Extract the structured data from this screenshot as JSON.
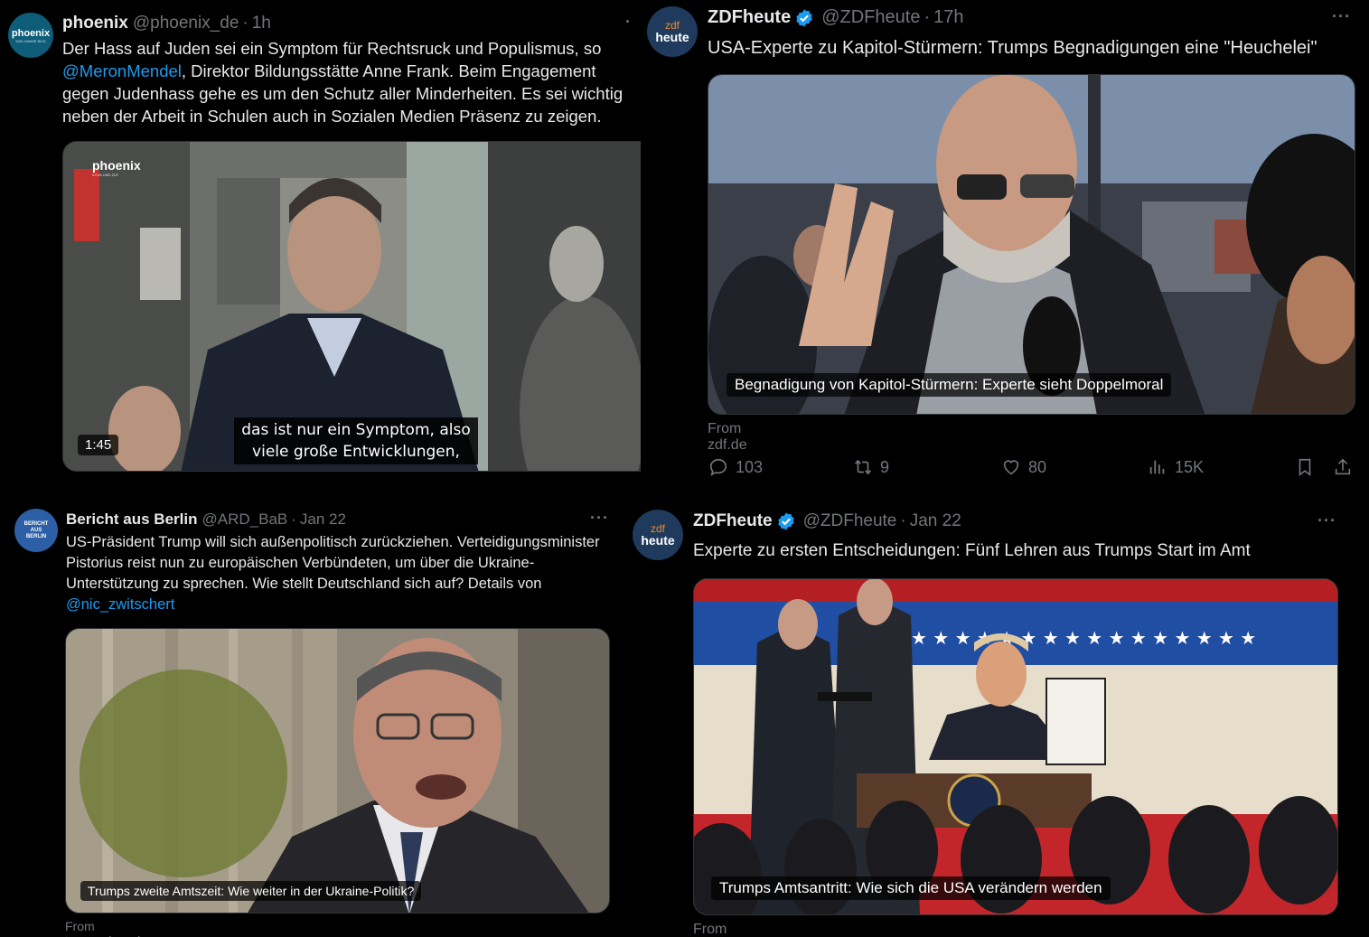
{
  "colors": {
    "background": "#000000",
    "text": "#e7e9ea",
    "muted": "#71767b",
    "link": "#1d9bf0",
    "verified": "#1d9bf0"
  },
  "tweets": [
    {
      "name": "phoenix",
      "handle": "@phoenix_de",
      "time": "1h",
      "avatar_text": "phoenix",
      "avatar_subtext": "DAS GANZE BILD",
      "text_before": "Der Hass auf Juden sei ein Symptom für Rechtsruck und Populismus, so ",
      "mention": "@MeronMendel",
      "text_after": ", Direktor Bildungsstätte Anne Frank. Beim Engagement gegen Judenhass gehe es um den Schutz aller Minderheiten. Es sei wichtig neben der Arbeit in Schulen auch in Sozialen Medien Präsenz zu zeigen.",
      "video_logo": "phoenix",
      "video_logo_sub": "KOVA UND ZDF",
      "subtitle_line1": "das ist nur ein Symptom, also",
      "subtitle_line2": "viele große Entwicklungen,",
      "duration": "1:45"
    },
    {
      "name": "ZDFheute",
      "handle": "@ZDFheute",
      "time": "17h",
      "avatar_text_top": "zdf",
      "avatar_text_bottom": "heute",
      "text": "USA-Experte zu Kapitol-Stürmern: Trumps Begnadigungen eine \"Heuchelei\"",
      "card_caption": "Begnadigung von Kapitol-Stürmern: Experte sieht Doppelmoral",
      "from": "From zdf.de",
      "stats": {
        "replies": "103",
        "reposts": "9",
        "likes": "80",
        "views": "15K"
      }
    },
    {
      "name": "Bericht aus Berlin",
      "handle": "@ARD_BaB",
      "time": "Jan 22",
      "avatar_text": "BERICHT AUS BERLIN",
      "text_before": "US-Präsident Trump will sich außenpolitisch zurückziehen. Verteidigungsminister Pistorius reist nun zu europäischen Verbündeten, um über die Ukraine-Unterstützung zu sprechen. Wie stellt Deutschland sich auf? Details von ",
      "mention": "@nic_zwitschert",
      "card_caption": "Trumps zweite Amtszeit: Wie weiter in der Ukraine-Politik?",
      "from": "From tagesschau.de"
    },
    {
      "name": "ZDFheute",
      "handle": "@ZDFheute",
      "time": "Jan 22",
      "avatar_text_top": "zdf",
      "avatar_text_bottom": "heute",
      "text": "Experte zu ersten Entscheidungen: Fünf Lehren aus Trumps Start im Amt",
      "card_caption": "Trumps Amtsantritt: Wie sich die USA verändern werden",
      "from": "From zdf.de"
    }
  ],
  "icons": [
    "more-icon",
    "verified-icon",
    "reply-icon",
    "repost-icon",
    "like-icon",
    "views-icon",
    "bookmark-icon",
    "share-icon"
  ]
}
